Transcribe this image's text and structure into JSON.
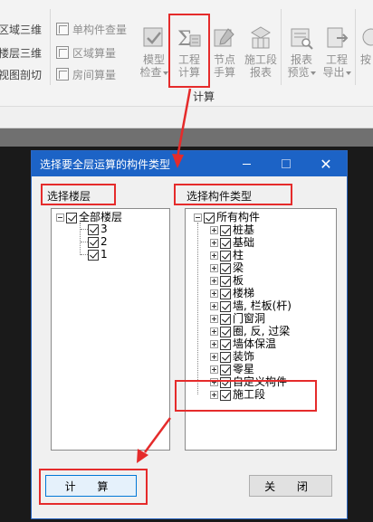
{
  "ribbon": {
    "left_col": [
      "区域三维",
      "楼层三维",
      "视图剖切"
    ],
    "mid_col": [
      "单构件查量",
      "区域算量",
      "房间算量"
    ],
    "buttons": [
      {
        "label1": "模型",
        "label2": "检查"
      },
      {
        "label1": "工程",
        "label2": "计算"
      },
      {
        "label1": "节点",
        "label2": "手算"
      },
      {
        "label1": "施工段",
        "label2": "报表"
      },
      {
        "label1": "报表",
        "label2": "预览"
      },
      {
        "label1": "工程",
        "label2": "导出"
      },
      {
        "label1": "按",
        "label2": ""
      }
    ],
    "group_label": "计算"
  },
  "dialog": {
    "title": "选择要全层运算的构件类型",
    "floor_panel_title": "选择楼层",
    "floor_root": "全部楼层",
    "floors": [
      "3",
      "2",
      "1"
    ],
    "component_panel_title": "选择构件类型",
    "component_root": "所有构件",
    "components": [
      "桩基",
      "基础",
      "柱",
      "梁",
      "板",
      "楼梯",
      "墙, 栏板(杆)",
      "门窗洞",
      "圈, 反, 过梁",
      "墙体保温",
      "装饰",
      "零星",
      "自定义构件",
      "施工段"
    ],
    "calc_button": "计 算",
    "close_button": "关 闭"
  },
  "colors": {
    "title_bar": "#1c63c6",
    "highlight": "#e52b2b"
  }
}
